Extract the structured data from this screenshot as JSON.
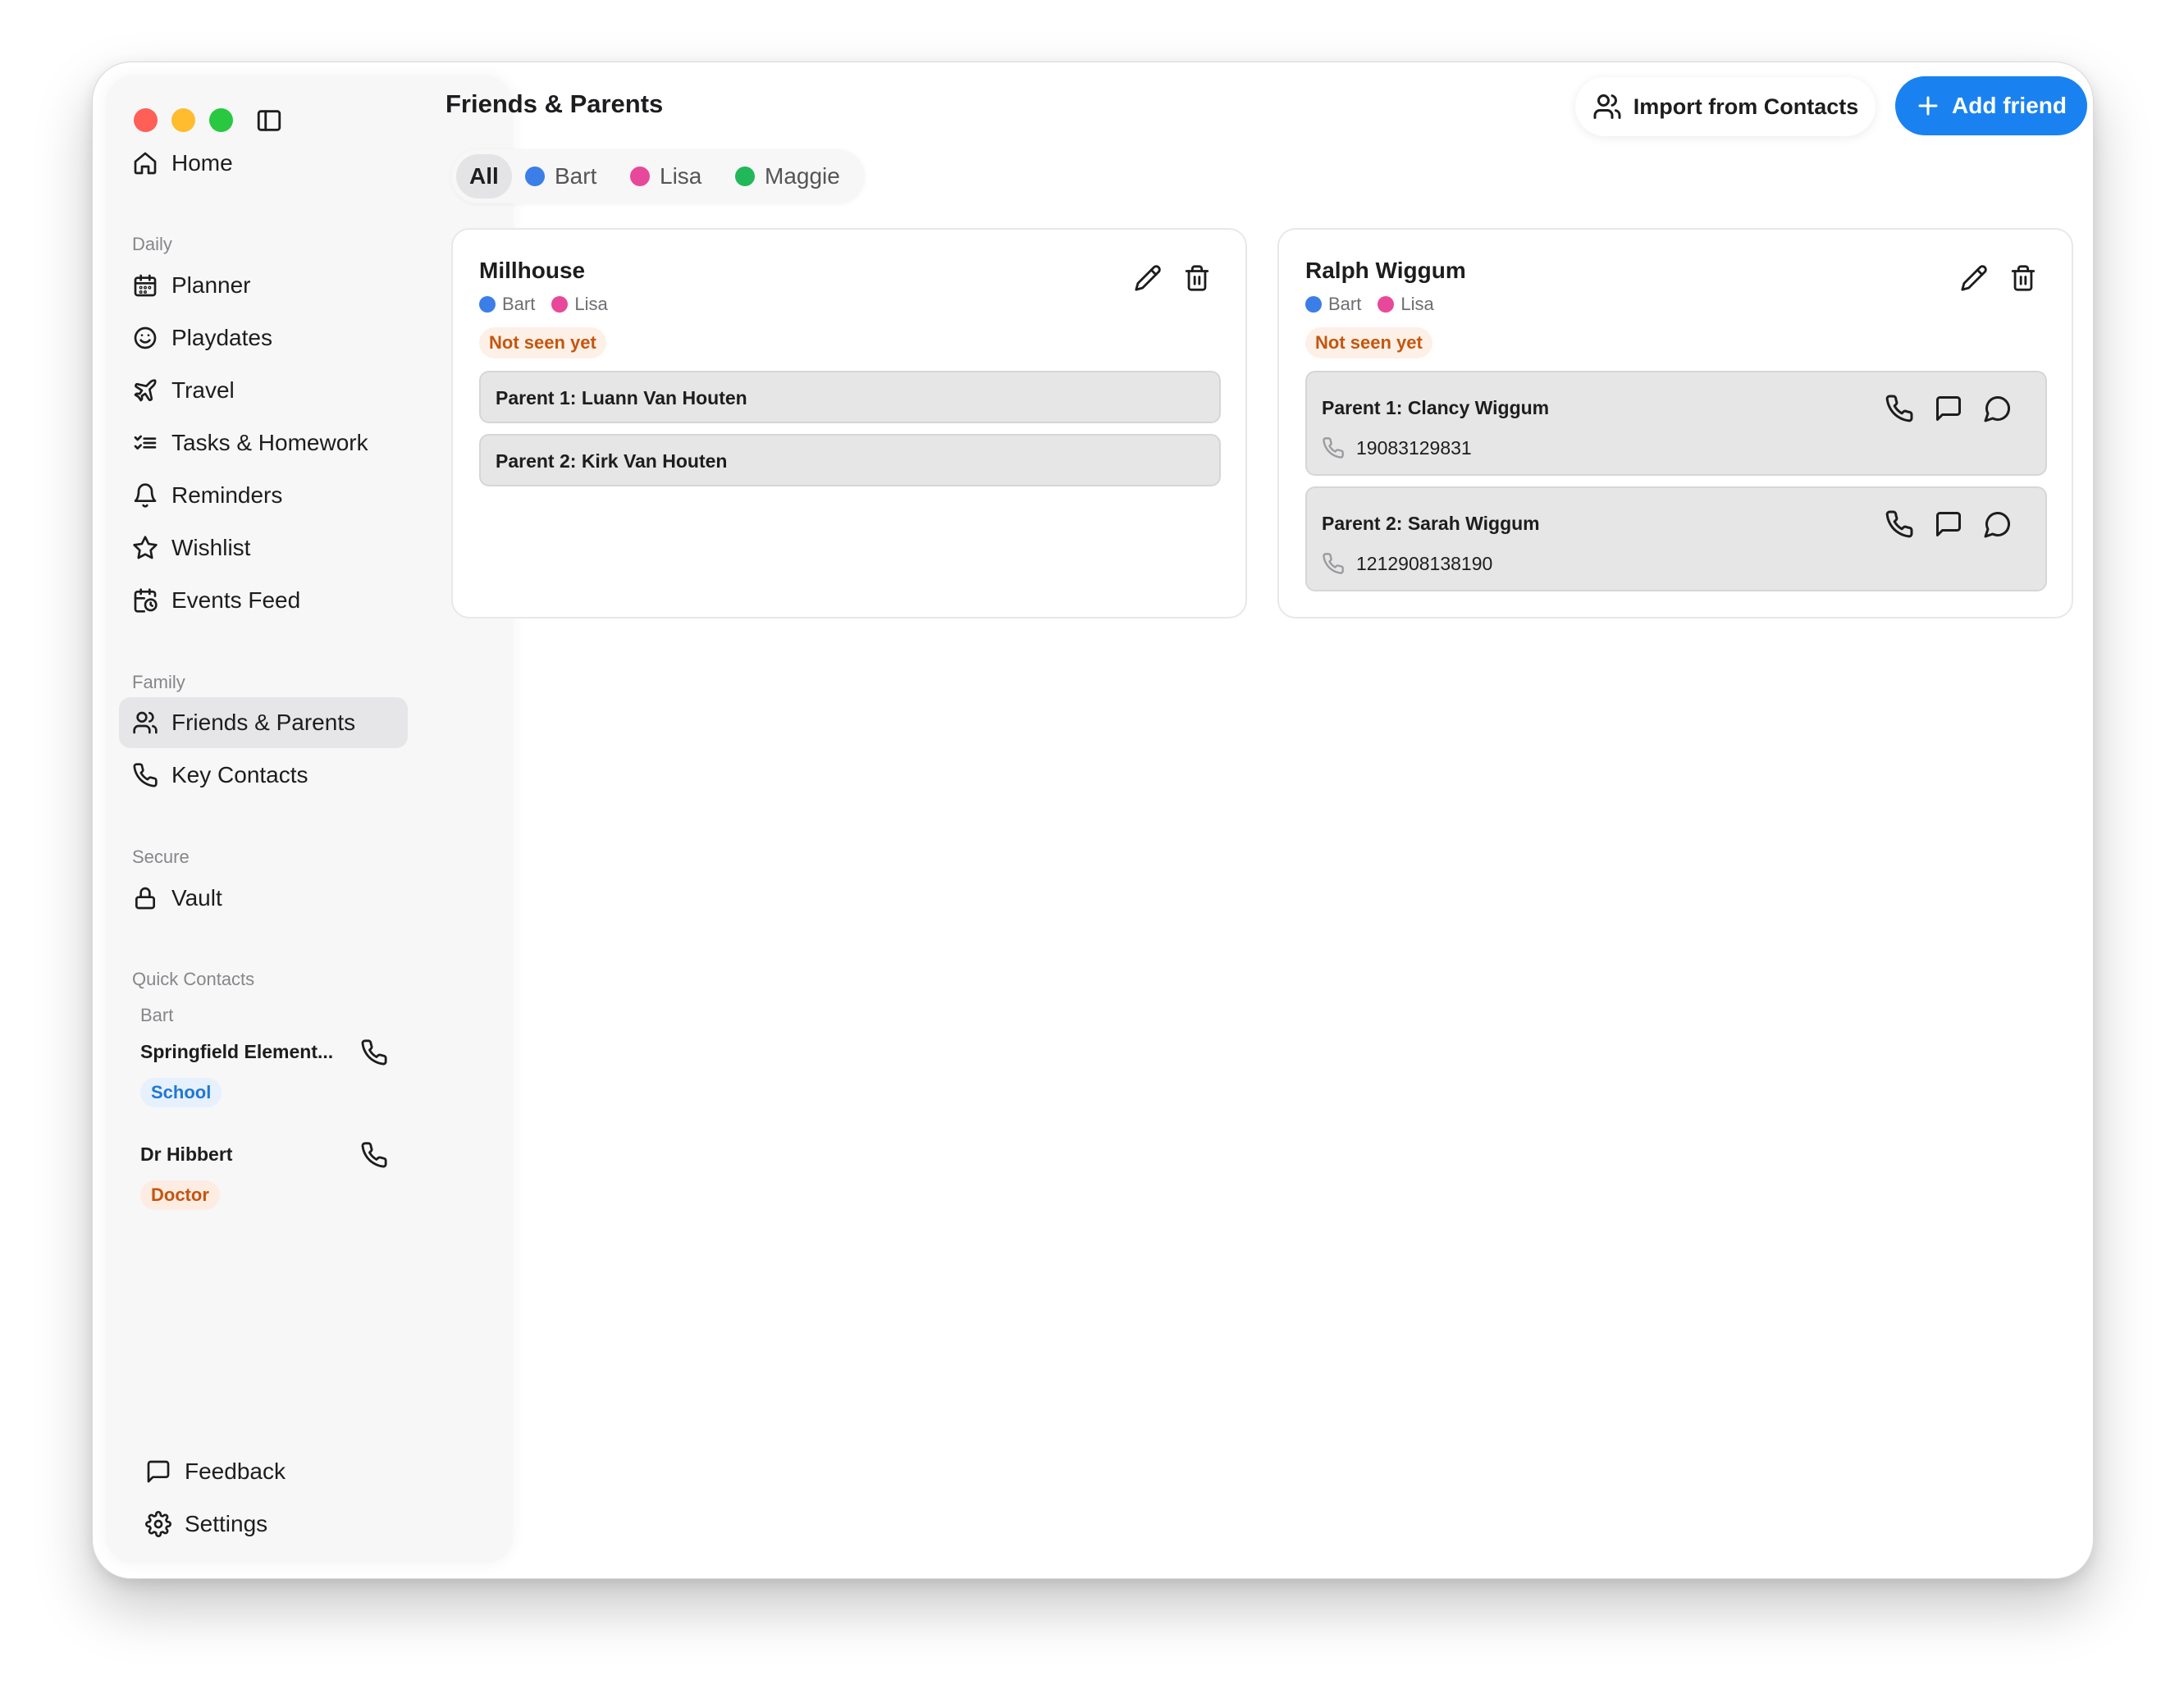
{
  "window": {
    "traffic_lights": {
      "close": "#ff5f57",
      "minimize": "#febc2e",
      "maximize": "#28c840"
    }
  },
  "sidebar": {
    "home": {
      "label": "Home",
      "icon": "home-icon"
    },
    "sections": {
      "daily": "Daily",
      "family": "Family",
      "secure": "Secure",
      "quick_contacts": "Quick Contacts"
    },
    "daily_items": [
      {
        "label": "Planner",
        "icon": "calendar-icon"
      },
      {
        "label": "Playdates",
        "icon": "smile-icon"
      },
      {
        "label": "Travel",
        "icon": "plane-icon"
      },
      {
        "label": "Tasks & Homework",
        "icon": "checklist-icon"
      },
      {
        "label": "Reminders",
        "icon": "bell-icon"
      },
      {
        "label": "Wishlist",
        "icon": "star-icon"
      },
      {
        "label": "Events Feed",
        "icon": "calendar-clock-icon"
      }
    ],
    "family_items": [
      {
        "label": "Friends & Parents",
        "icon": "users-icon",
        "active": true
      },
      {
        "label": "Key Contacts",
        "icon": "phone-icon"
      }
    ],
    "secure_items": [
      {
        "label": "Vault",
        "icon": "lock-icon"
      }
    ],
    "quick_contacts": {
      "child": "Bart",
      "contacts": [
        {
          "name": "Springfield Element...",
          "tag": "School"
        },
        {
          "name": "Dr Hibbert",
          "tag": "Doctor"
        }
      ]
    },
    "footer": {
      "feedback": {
        "label": "Feedback",
        "icon": "message-square-icon"
      },
      "settings": {
        "label": "Settings",
        "icon": "gear-icon"
      }
    }
  },
  "header": {
    "title": "Friends & Parents",
    "import_label": "Import from Contacts",
    "add_label": "Add friend",
    "accent": "#1a82f0"
  },
  "filters": [
    {
      "label": "All",
      "active": true
    },
    {
      "label": "Bart",
      "color": "#3b7ee8"
    },
    {
      "label": "Lisa",
      "color": "#e8489a"
    },
    {
      "label": "Maggie",
      "color": "#22b85a"
    }
  ],
  "cards": [
    {
      "name": "Millhouse",
      "kids": [
        "Bart",
        "Lisa"
      ],
      "status": "Not seen yet",
      "parents": [
        {
          "label": "Parent 1: Luann Van Houten"
        },
        {
          "label": "Parent 2: Kirk Van Houten"
        }
      ]
    },
    {
      "name": "Ralph Wiggum",
      "kids": [
        "Bart",
        "Lisa"
      ],
      "status": "Not seen yet",
      "parents": [
        {
          "label": "Parent 1: Clancy Wiggum",
          "phone": "19083129831"
        },
        {
          "label": "Parent 2: Sarah Wiggum",
          "phone": "1212908138190"
        }
      ]
    }
  ]
}
